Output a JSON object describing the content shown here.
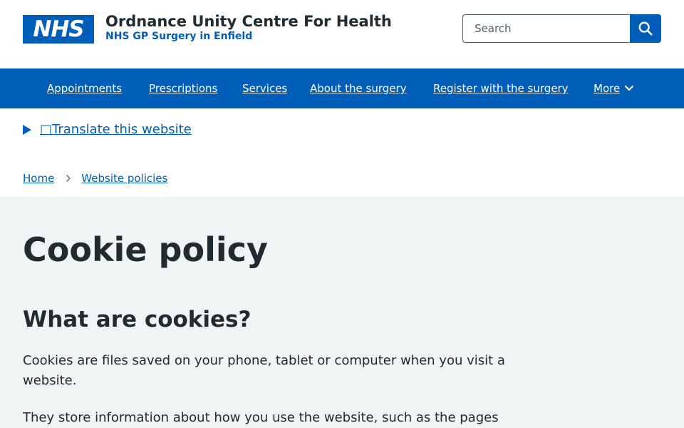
{
  "header": {
    "logo_text": "NHS",
    "org_name": "Ordnance Unity Centre For Health",
    "org_subtitle": "NHS GP Surgery in Enfield",
    "search_placeholder": "Search"
  },
  "nav": {
    "items": [
      {
        "label": "Appointments"
      },
      {
        "label": "Prescriptions"
      },
      {
        "label": "Services"
      },
      {
        "label": "About the surgery"
      },
      {
        "label": "Register with the surgery"
      },
      {
        "label": "More"
      }
    ]
  },
  "translate": {
    "label": "□Translate this website"
  },
  "breadcrumb": {
    "items": [
      {
        "label": "Home"
      },
      {
        "label": "Website policies"
      }
    ]
  },
  "main": {
    "title": "Cookie policy",
    "heading": "What are cookies?",
    "paragraph_1": "Cookies are files saved on your phone, tablet or computer when you visit a website.",
    "paragraph_2": "They store information about how you use the website, such as the pages"
  },
  "colors": {
    "nhs_blue": "#005eb8",
    "text": "#212b32",
    "background_grey": "#f0f4f5"
  }
}
